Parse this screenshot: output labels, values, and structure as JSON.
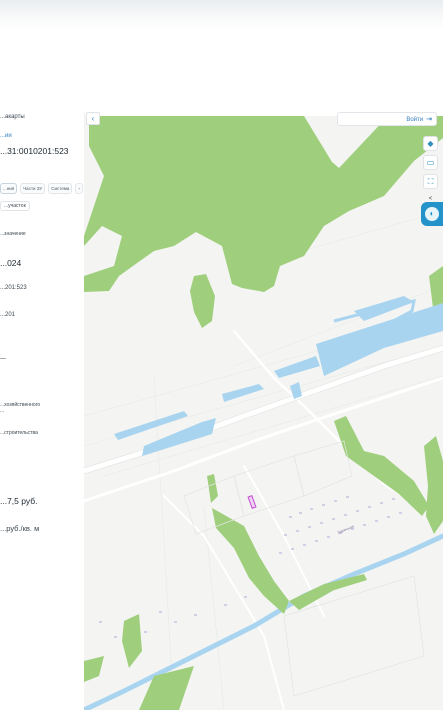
{
  "panel": {
    "header_partial": "...акарты",
    "cad_label": "...ии",
    "cad_number": "...31:0010201:523",
    "tabs": [
      "...ния",
      "Части ЗУ",
      "Система"
    ],
    "tab_more": "›",
    "chip": "...участок",
    "field_label_1": "...значение",
    "value_year": "...024",
    "value_cad2": "...201:523",
    "value_short": "...201",
    "value_dash": "—",
    "desc_line1": "...хозяйственного",
    "desc_line2": "...",
    "desc_line3": "...строительства",
    "price_total": "...7,5 руб.",
    "price_unit": "...руб./кв. м"
  },
  "toolbar": {
    "back_icon": "chevron-left-icon",
    "login_label": "Войти",
    "login_icon": "login-arrow-icon"
  },
  "controls": [
    {
      "name": "location-icon"
    },
    {
      "name": "layers-icon"
    },
    {
      "name": "fullscreen-icon"
    },
    {
      "name": "share-icon"
    }
  ],
  "map": {
    "colors": {
      "background": "#f4f5f2",
      "forest": "#9fcf7d",
      "water": "#a9d4f0",
      "road": "#ffffff",
      "parcel_highlight": "#c34ed1"
    },
    "street_label": "Заречная"
  }
}
